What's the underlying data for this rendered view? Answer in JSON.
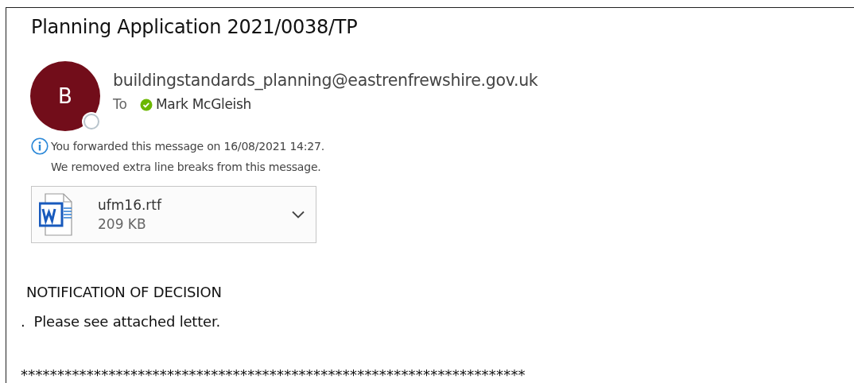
{
  "subject": "Planning Application 2021/0038/TP",
  "sender": {
    "initial": "B",
    "address": "buildingstandards_planning@eastrenfrewshire.gov.uk"
  },
  "recipients": {
    "label": "To",
    "items": [
      {
        "name": "Mark McGleish",
        "available": true
      }
    ]
  },
  "info_lines": [
    "You forwarded this message on 16/08/2021 14:27.",
    "We removed extra line breaks from this message."
  ],
  "attachment": {
    "filename": "ufm16.rtf",
    "size": "209 KB"
  },
  "body": [
    "NOTIFICATION OF DECISION",
    ".  Please see attached letter.",
    "*********************************************************************"
  ]
}
